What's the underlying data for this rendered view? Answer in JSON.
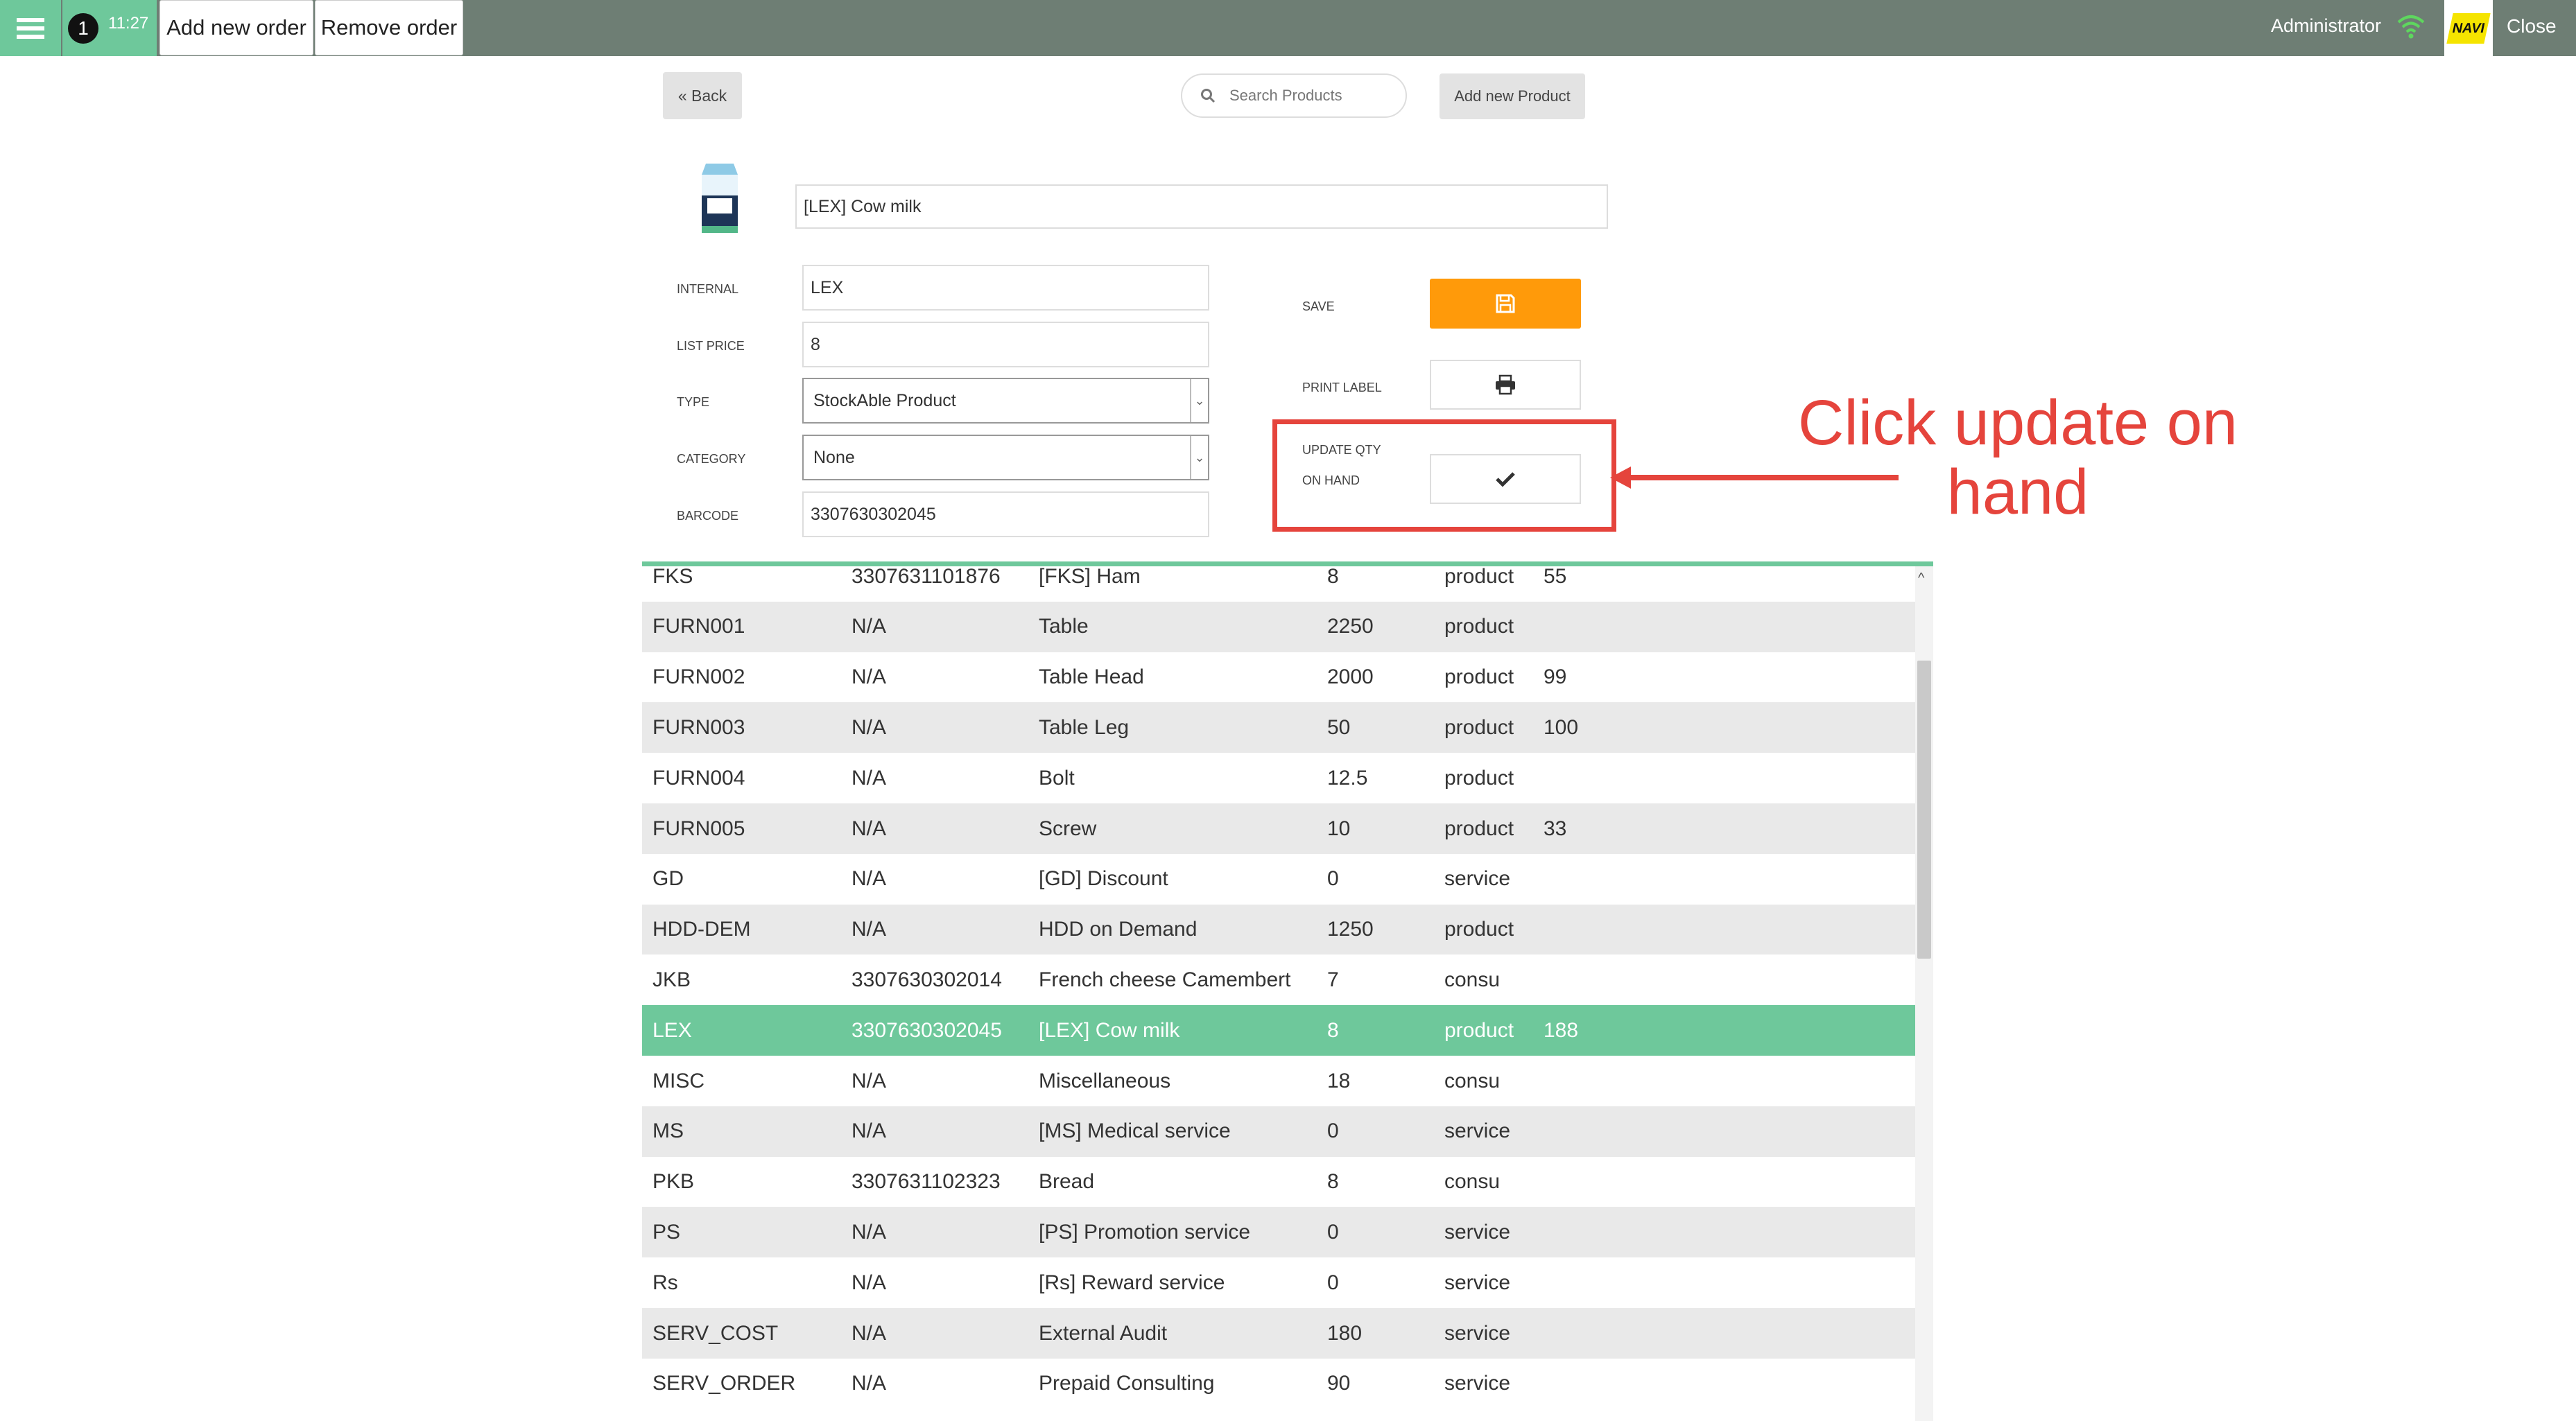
{
  "topbar": {
    "order_number": "1",
    "order_time": "11:27",
    "add_order_label": "Add new order",
    "remove_order_label": "Remove order",
    "user_name": "Administrator",
    "logo_text": "NAVI",
    "close_label": "Close"
  },
  "toolbar": {
    "back_label": "Back",
    "search_placeholder": "Search Products",
    "add_product_label": "Add new Product"
  },
  "product": {
    "name": "[LEX] Cow milk",
    "fields": {
      "internal_label": "INTERNAL",
      "internal_value": "LEX",
      "list_price_label": "LIST PRICE",
      "list_price_value": "8",
      "type_label": "TYPE",
      "type_value": "StockAble Product",
      "category_label": "CATEGORY",
      "category_value": "None",
      "barcode_label": "BARCODE",
      "barcode_value": "3307630302045"
    },
    "actions": {
      "save_label": "SAVE",
      "print_label": "PRINT LABEL",
      "update_label_line1": "UPDATE QTY",
      "update_label_line2": "ON HAND"
    }
  },
  "annotation": {
    "line1": "Click update on",
    "line2": "hand",
    "color": "#e5443c"
  },
  "table": {
    "rows": [
      {
        "code": "FKS",
        "barcode": "3307631101876",
        "name": "[FKS] Ham",
        "price": "8",
        "type": "product",
        "qty": "55"
      },
      {
        "code": "FURN001",
        "barcode": "N/A",
        "name": "Table",
        "price": "2250",
        "type": "product",
        "qty": ""
      },
      {
        "code": "FURN002",
        "barcode": "N/A",
        "name": "Table Head",
        "price": "2000",
        "type": "product",
        "qty": "99"
      },
      {
        "code": "FURN003",
        "barcode": "N/A",
        "name": "Table Leg",
        "price": "50",
        "type": "product",
        "qty": "100"
      },
      {
        "code": "FURN004",
        "barcode": "N/A",
        "name": "Bolt",
        "price": "12.5",
        "type": "product",
        "qty": ""
      },
      {
        "code": "FURN005",
        "barcode": "N/A",
        "name": "Screw",
        "price": "10",
        "type": "product",
        "qty": "33"
      },
      {
        "code": "GD",
        "barcode": "N/A",
        "name": "[GD] Discount",
        "price": "0",
        "type": "service",
        "qty": ""
      },
      {
        "code": "HDD-DEM",
        "barcode": "N/A",
        "name": "HDD on Demand",
        "price": "1250",
        "type": "product",
        "qty": ""
      },
      {
        "code": "JKB",
        "barcode": "3307630302014",
        "name": "French cheese Camembert",
        "price": "7",
        "type": "consu",
        "qty": ""
      },
      {
        "code": "LEX",
        "barcode": "3307630302045",
        "name": "[LEX] Cow milk",
        "price": "8",
        "type": "product",
        "qty": "188"
      },
      {
        "code": "MISC",
        "barcode": "N/A",
        "name": "Miscellaneous",
        "price": "18",
        "type": "consu",
        "qty": ""
      },
      {
        "code": "MS",
        "barcode": "N/A",
        "name": "[MS] Medical service",
        "price": "0",
        "type": "service",
        "qty": ""
      },
      {
        "code": "PKB",
        "barcode": "3307631102323",
        "name": "Bread",
        "price": "8",
        "type": "consu",
        "qty": ""
      },
      {
        "code": "PS",
        "barcode": "N/A",
        "name": "[PS] Promotion service",
        "price": "0",
        "type": "service",
        "qty": ""
      },
      {
        "code": "Rs",
        "barcode": "N/A",
        "name": "[Rs] Reward service",
        "price": "0",
        "type": "service",
        "qty": ""
      },
      {
        "code": "SERV_COST",
        "barcode": "N/A",
        "name": "External Audit",
        "price": "180",
        "type": "service",
        "qty": ""
      },
      {
        "code": "SERV_ORDER",
        "barcode": "N/A",
        "name": "Prepaid Consulting",
        "price": "90",
        "type": "service",
        "qty": ""
      }
    ]
  },
  "colors": {
    "accent_green": "#6ec89b",
    "topbar_gray": "#6e7e74",
    "save_orange": "#ff9a0a"
  }
}
